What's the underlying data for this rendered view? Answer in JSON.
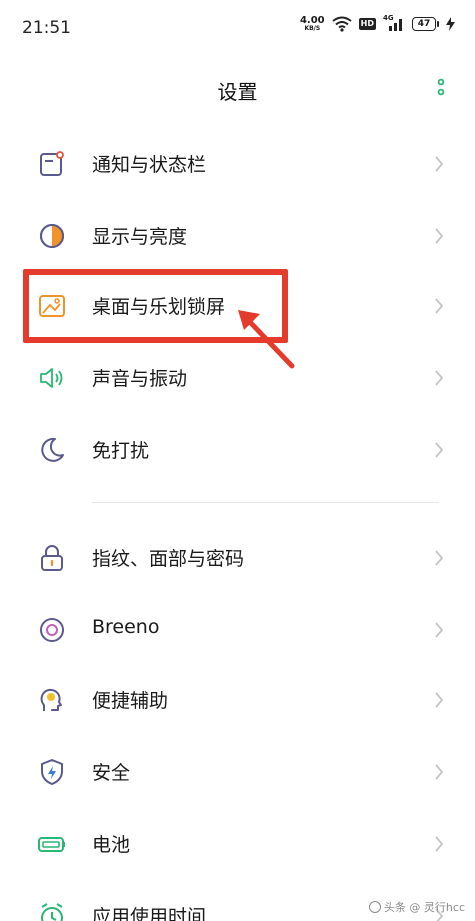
{
  "status_bar": {
    "time": "21:51",
    "net_speed_value": "4.00",
    "net_speed_unit": "KB/S",
    "hd_label": "HD",
    "signal_type": "4G",
    "battery_level": "47"
  },
  "header": {
    "title": "设置"
  },
  "settings": {
    "items": [
      {
        "label": "通知与状态栏",
        "icon": "notification-icon"
      },
      {
        "label": "显示与亮度",
        "icon": "brightness-icon"
      },
      {
        "label": "桌面与乐划锁屏",
        "icon": "wallpaper-icon",
        "highlighted": true
      },
      {
        "label": "声音与振动",
        "icon": "speaker-icon"
      },
      {
        "label": "免打扰",
        "icon": "moon-icon"
      },
      {
        "label": "指纹、面部与密码",
        "icon": "lock-icon"
      },
      {
        "label": "Breeno",
        "icon": "breeno-icon"
      },
      {
        "label": "便捷辅助",
        "icon": "assist-icon"
      },
      {
        "label": "安全",
        "icon": "shield-icon"
      },
      {
        "label": "电池",
        "icon": "battery-icon"
      },
      {
        "label": "应用使用时间",
        "icon": "app-time-icon"
      }
    ]
  },
  "colors": {
    "highlight": "#e53b2c",
    "accent_green": "#2bb673",
    "orange": "#f0932b",
    "purple": "#5b5a8c"
  },
  "watermark": {
    "text": "头条 @ 灵行hcc"
  }
}
